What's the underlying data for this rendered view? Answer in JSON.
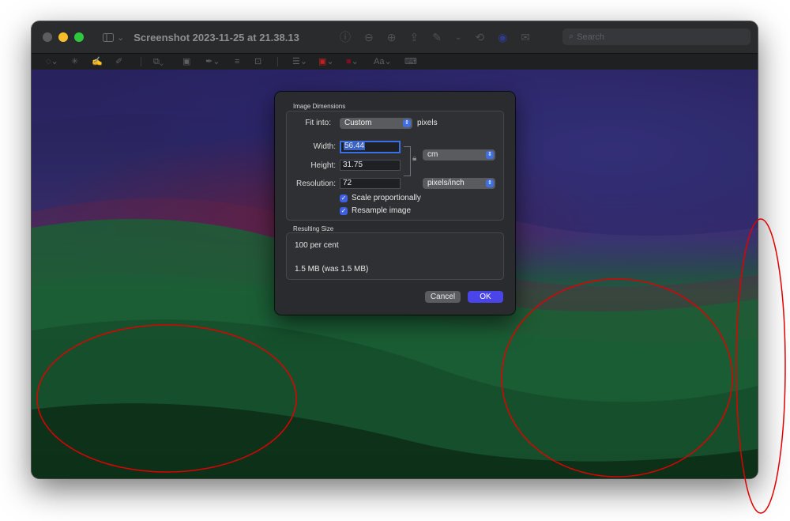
{
  "window": {
    "title": "Screenshot 2023-11-25 at 21.38.13",
    "search_placeholder": "Search"
  },
  "titlebar_tools": [
    "info-icon",
    "zoom-out-icon",
    "zoom-in-icon",
    "share-icon",
    "markup-icon",
    "rotate-icon",
    "highlight-icon",
    "inspector-icon"
  ],
  "toolbar_tools": [
    "selection-icon",
    "instant-alpha-icon",
    "sketch-icon",
    "draw-icon",
    "shapes-icon",
    "text-box-icon",
    "sign-icon",
    "adjust-color-icon",
    "adjust-size-icon",
    "shape-style-icon",
    "border-color-icon",
    "fill-color-icon",
    "text-style-icon",
    "annotation-icon"
  ],
  "text_style_label": "Aa",
  "dialog": {
    "image_dimensions_label": "Image Dimensions",
    "fit_into_label": "Fit into:",
    "fit_into_value": "Custom",
    "fit_into_unit": "pixels",
    "width_label": "Width:",
    "width_value": "56.44",
    "height_label": "Height:",
    "height_value": "31.75",
    "unit_value": "cm",
    "resolution_label": "Resolution:",
    "resolution_value": "72",
    "resolution_unit": "pixels/inch",
    "scale_proportionally_label": "Scale proportionally",
    "scale_proportionally_checked": true,
    "resample_image_label": "Resample image",
    "resample_image_checked": true,
    "resulting_size_label": "Resulting Size",
    "result_percent": "100 per cent",
    "result_file_size": "1.5 MB (was 1.5 MB)",
    "cancel_label": "Cancel",
    "ok_label": "OK"
  },
  "colors": {
    "accent": "#4a45e8",
    "annotation_ring": "#e00000"
  }
}
